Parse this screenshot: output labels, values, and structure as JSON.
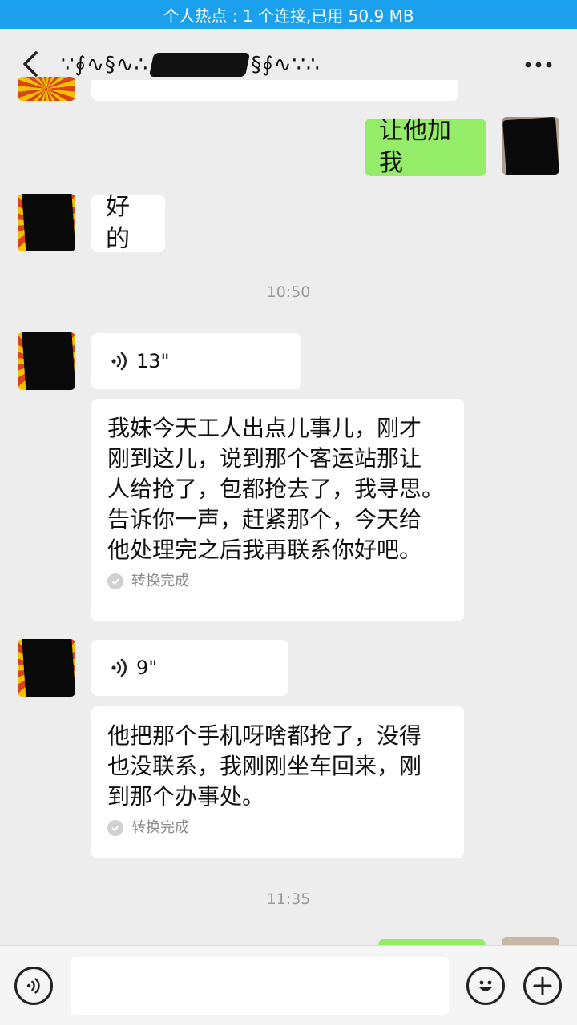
{
  "status_bar": {
    "text": "个人热点 : 1 个连接,已用 50.9 MB"
  },
  "nav": {
    "title_prefix": "∵∮∿§∿∴",
    "title_suffix": "§∮∿∵∴"
  },
  "messages": {
    "m1": {
      "sender": "self",
      "text": "让他加我"
    },
    "m2": {
      "sender": "other",
      "text": "好的"
    },
    "time1": "10:50",
    "m3": {
      "sender": "other",
      "voice_duration": "13\"",
      "transcript_lines": [
        "我妹今天工人出点儿事儿，刚才",
        "刚到这儿，说到那个客运站那让",
        "人给抢了，包都抢去了，我寻思。",
        "告诉你一声，赶紧那个，今天给",
        "他处理完之后我再联系你好吧。"
      ],
      "transcript_status": "转换完成"
    },
    "m4": {
      "sender": "other",
      "voice_duration": "9\"",
      "transcript_lines": [
        "他把那个手机呀啥都抢了，没得",
        "也没联系，我刚刚坐车回来，刚",
        "到那个办事处。"
      ],
      "transcript_status": "转换完成"
    },
    "time2": "11:35"
  },
  "input_bar": {
    "placeholder": ""
  },
  "icons": {
    "back": "chevron-left-icon",
    "more": "more-dots-icon",
    "voice_mode": "voice-icon",
    "emoji": "smiley-icon",
    "plus": "plus-icon",
    "check": "check-icon"
  },
  "colors": {
    "status_bar": "#1aa0ec",
    "self_bubble": "#95ec69",
    "background": "#ededed"
  }
}
